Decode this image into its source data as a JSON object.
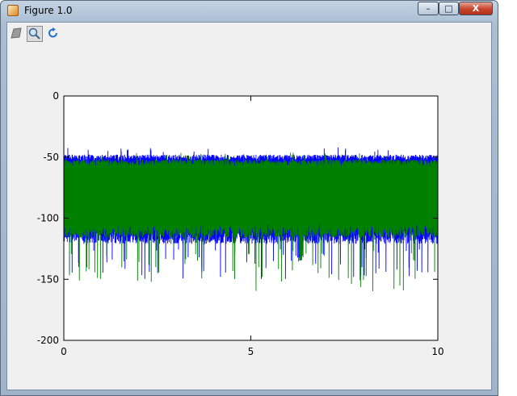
{
  "window": {
    "title": "Figure 1.0",
    "controls": {
      "minimize": "–",
      "maximize": "□",
      "close": "X"
    }
  },
  "toolbar": {
    "tools": [
      {
        "icon": "edit-icon",
        "active": false
      },
      {
        "icon": "zoom-icon",
        "active": true
      },
      {
        "icon": "rotate-icon",
        "active": false
      }
    ]
  },
  "chart_data": {
    "type": "line",
    "xlim": [
      0,
      10
    ],
    "ylim": [
      -200,
      0
    ],
    "xticks": [
      0,
      5,
      10
    ],
    "yticks": [
      0,
      -50,
      -100,
      -150,
      -200
    ],
    "xtick_labels": [
      "0",
      "5",
      "10"
    ],
    "ytick_labels": [
      "0",
      "-50",
      "-100",
      "-150",
      "-200"
    ],
    "grid": false,
    "series": [
      {
        "color": "#0000ff",
        "upper_envelope": -48,
        "lower_envelope": -115,
        "deepest_troughs": [
          -150,
          -140
        ],
        "notable_dips": [
          6.3
        ]
      },
      {
        "color": "#008000",
        "upper_envelope": -52,
        "lower_envelope": -110,
        "deepest_troughs": [
          -160,
          -155
        ],
        "notable_dips": [
          6.35
        ]
      }
    ]
  }
}
